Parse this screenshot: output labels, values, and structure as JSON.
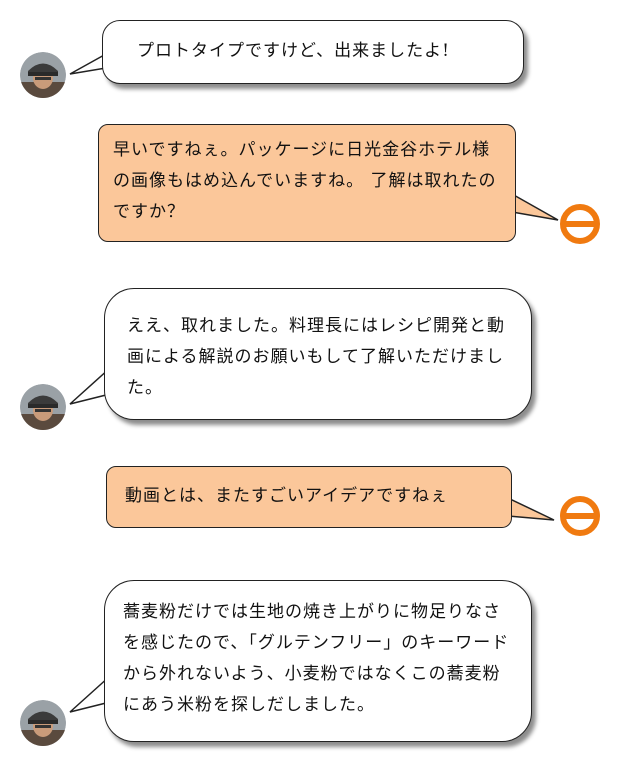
{
  "chat": {
    "messages": [
      {
        "speaker": "chef",
        "text": "プロトタイプですけど、出来ましたよ!"
      },
      {
        "speaker": "company",
        "text": "早いですねぇ。パッケージに日光金谷ホテル様の画像もはめ込んでいますね。 了解は取れたのですか？"
      },
      {
        "speaker": "chef",
        "text": "ええ、取れました。料理長にはレシピ開発と動画による解説のお願いもして了解いただけました。"
      },
      {
        "speaker": "company",
        "text": "動画とは、またすごいアイデアですねぇ"
      },
      {
        "speaker": "chef",
        "text": "蕎麦粉だけでは生地の焼き上がりに物足りなさを感じたので、「グルテンフリー」のキーワードから外れないよう、小麦粉ではなくこの蕎麦粉にあう米粉を探しだしました。"
      }
    ]
  },
  "colors": {
    "bubble_orange": "#fbc79a",
    "logo_orange": "#f07a10",
    "outline": "#222222"
  },
  "icons": {
    "chef_avatar": "chef-avatar",
    "company_logo": "company-logo-icon"
  }
}
